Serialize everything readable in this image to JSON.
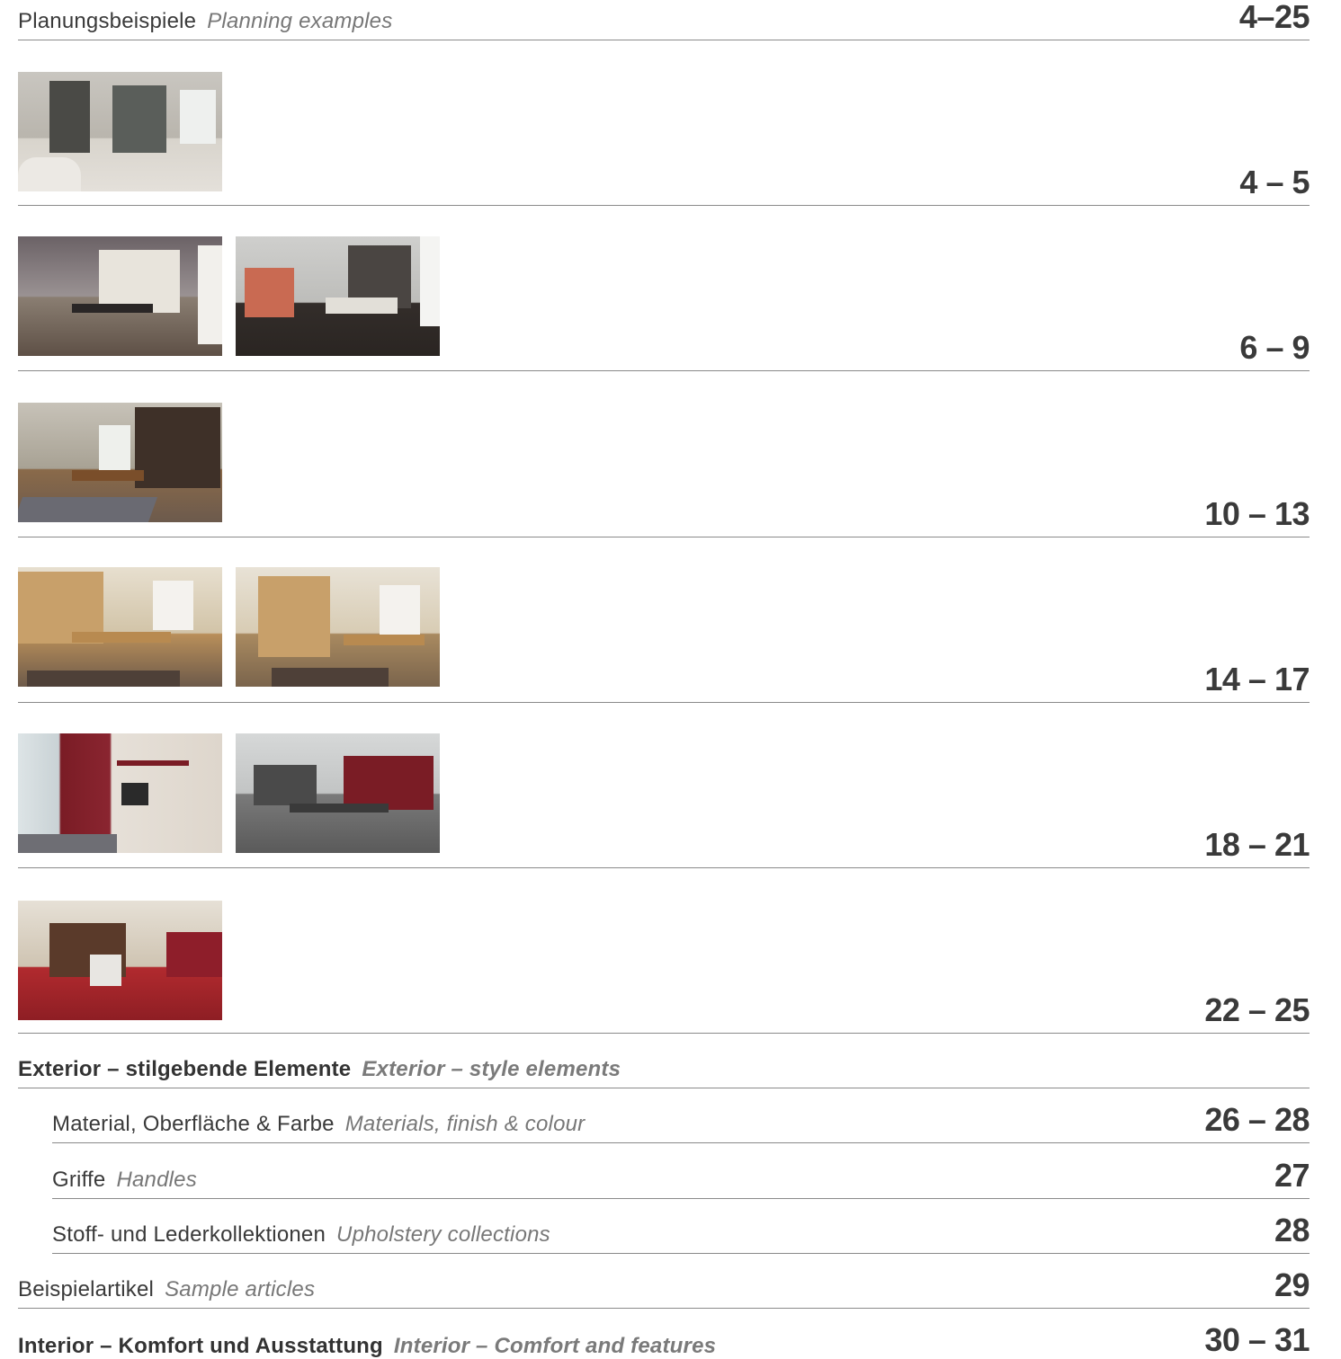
{
  "rows": [
    {
      "de": "Planungsbeispiele",
      "en": "Planning examples",
      "pages": "4–25"
    },
    {
      "pages": "4 – 5"
    },
    {
      "pages": "6 – 9"
    },
    {
      "pages": "10 – 13"
    },
    {
      "pages": "14 – 17"
    },
    {
      "pages": "18 – 21"
    },
    {
      "pages": "22 – 25"
    },
    {
      "de": "Exterior – stilgebende Elemente",
      "en": "Exterior – style elements",
      "pages": ""
    },
    {
      "de": "Material, Oberfläche & Farbe",
      "en": "Materials, finish & colour",
      "pages": "26 – 28"
    },
    {
      "de": "Griffe",
      "en": "Handles",
      "pages": "27"
    },
    {
      "de": "Stoff- und Lederkollektionen",
      "en": "Upholstery collections",
      "pages": "28"
    },
    {
      "de": "Beispielartikel",
      "en": "Sample articles",
      "pages": "29"
    },
    {
      "de": "Interior – Komfort und Ausstattung",
      "en": "Interior – Comfort and features",
      "pages": "30 – 31"
    }
  ]
}
